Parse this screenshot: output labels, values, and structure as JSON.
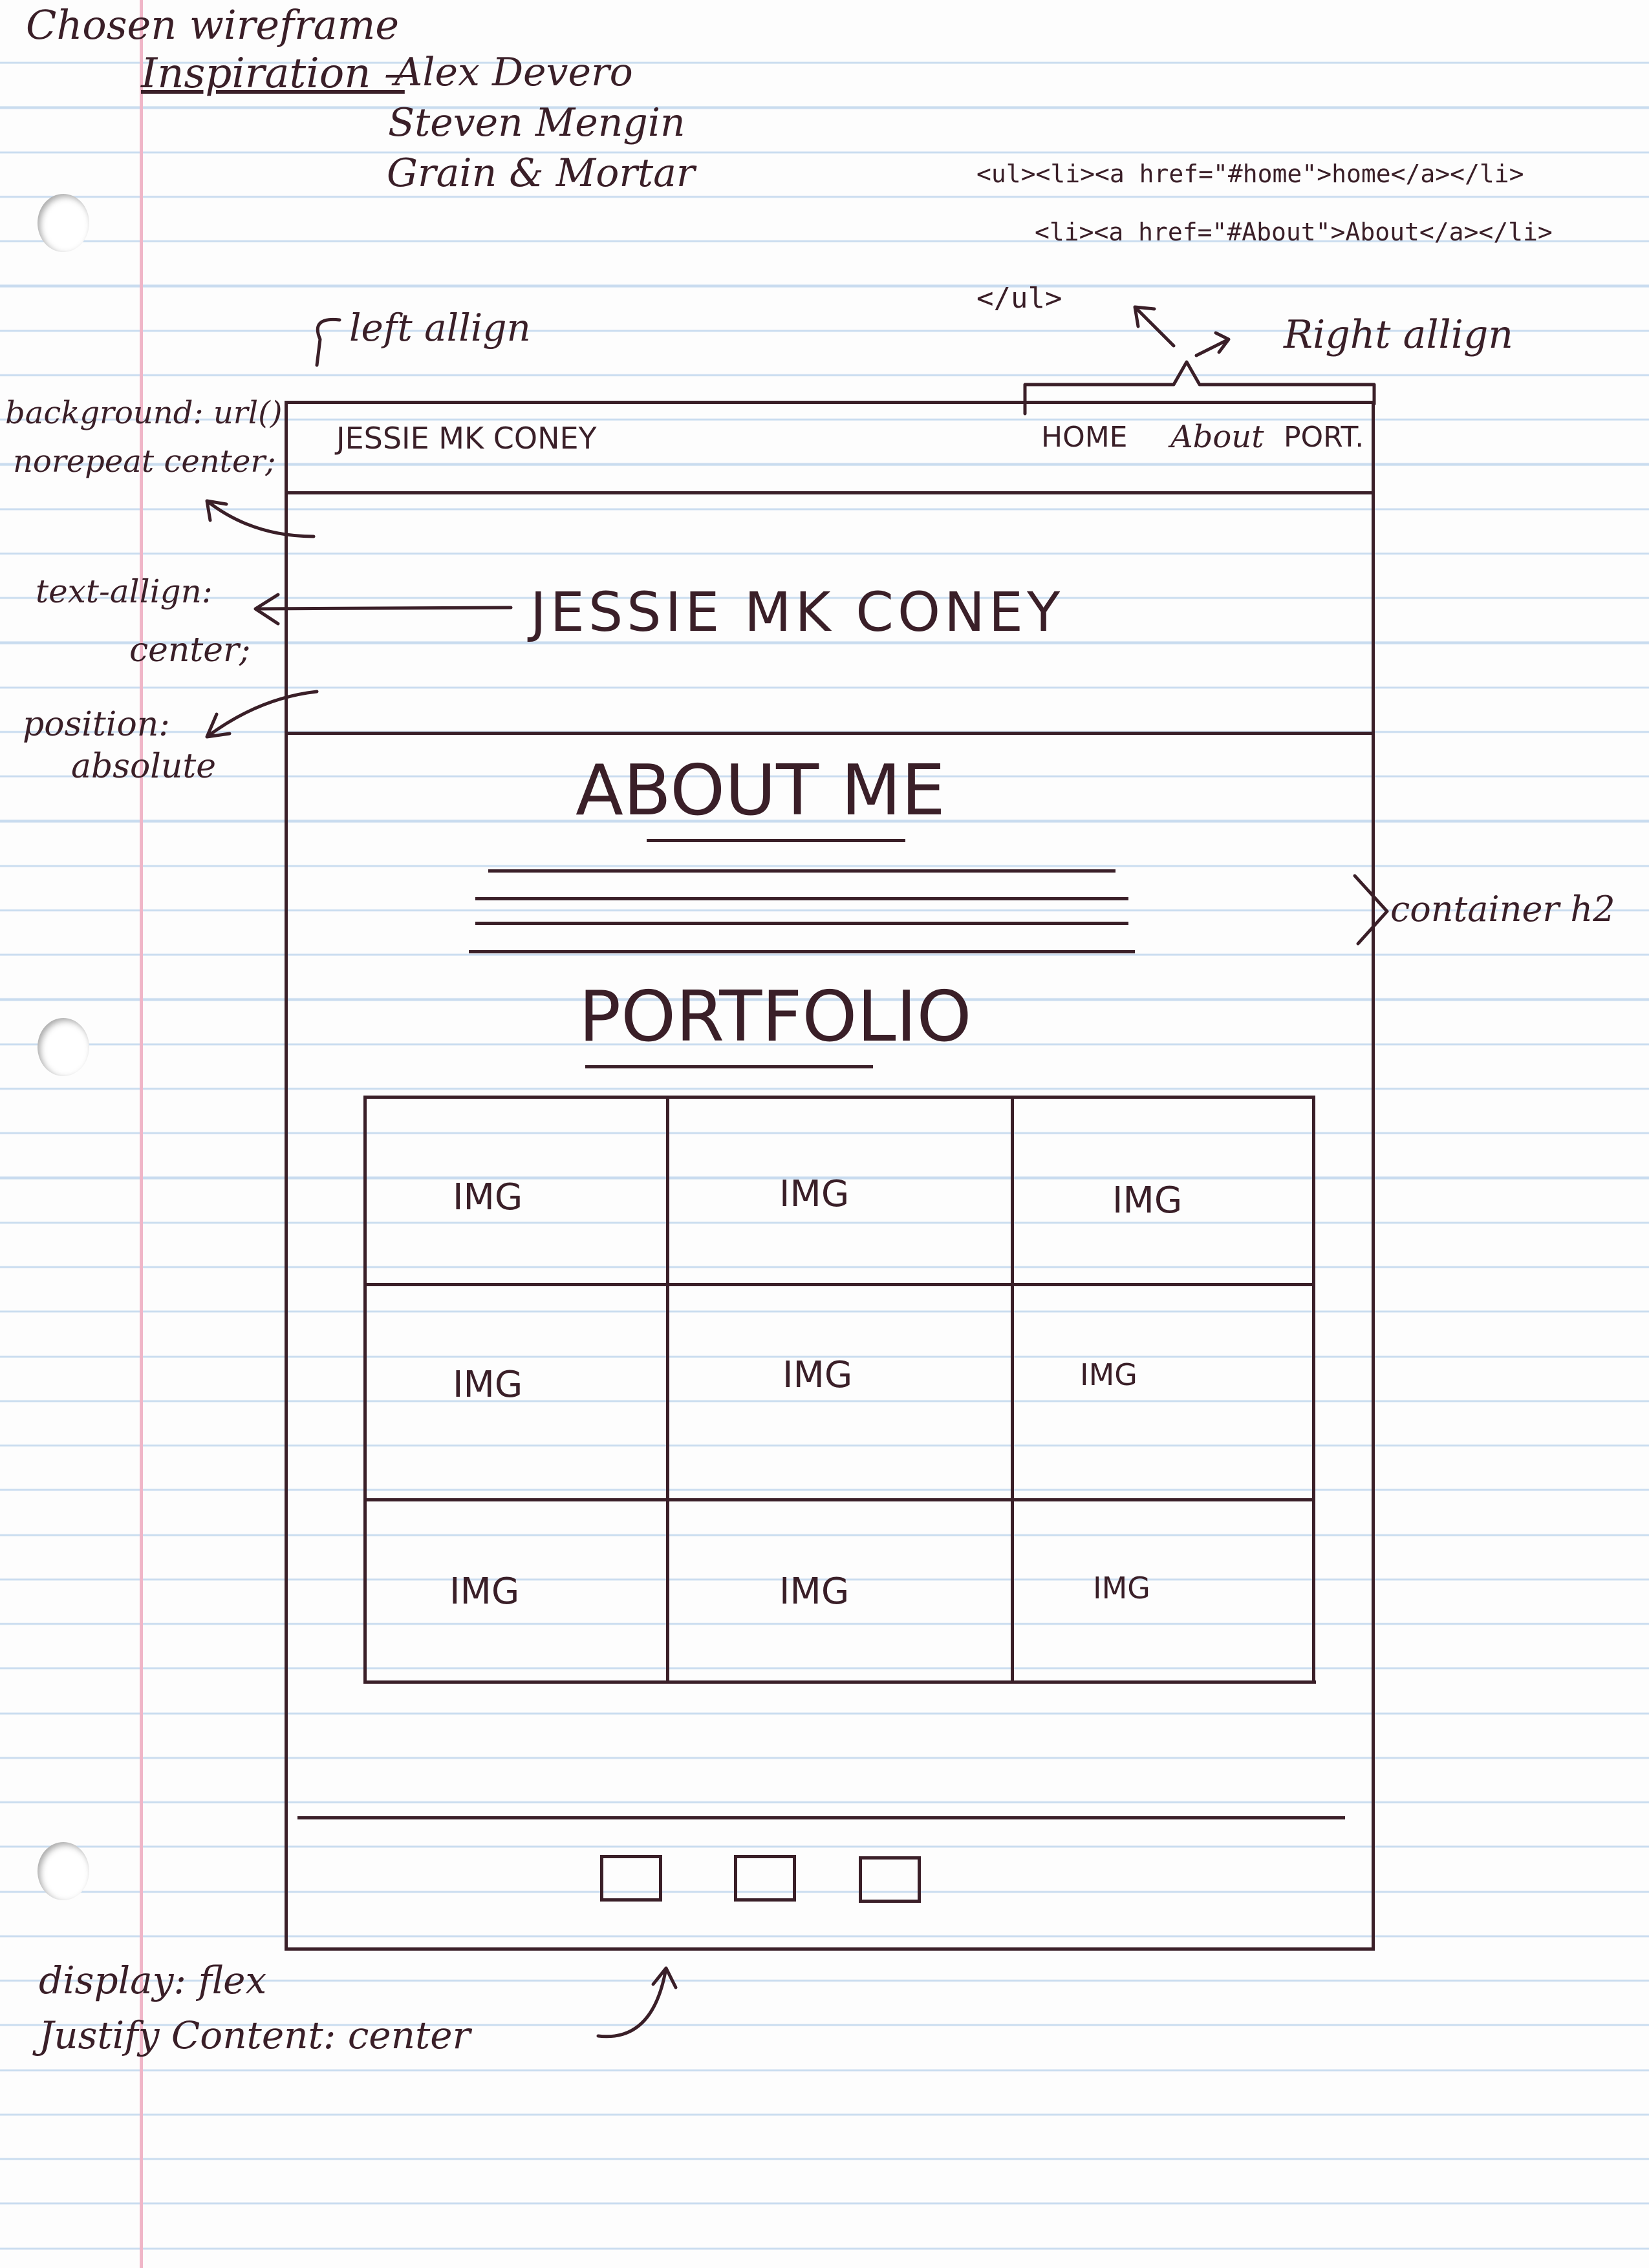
{
  "notes": {
    "heading": "Chosen wireframe",
    "inspiration_label": "Inspiration –",
    "inspiration": [
      "Alex Devero",
      "Steven Mengin",
      "Grain & Mortar"
    ],
    "code_line1": "<ul><li><a href=\"#home\">home</a></li>",
    "code_line2": "<li><a href=\"#About\">About</a></li>",
    "code_line3": "</ul>",
    "right_align": "Right allign",
    "left_align": "left allign",
    "bg_line1": "background: url()",
    "bg_line2": "norepeat center;",
    "text_align_line1": "text-allign:",
    "text_align_line2": "center;",
    "position_line1": "position:",
    "position_line2": "absolute",
    "container": "container h2",
    "flex_line1": "display: flex",
    "flex_line2": "Justify Content: center"
  },
  "wireframe": {
    "nav_brand": "JESSIE MK CONEY",
    "nav_links": [
      "HOME",
      "About",
      "PORT."
    ],
    "hero_title": "JESSIE MK CONEY",
    "about_heading": "ABOUT ME",
    "portfolio_heading": "PORTFOLIO",
    "grid_cells": [
      "IMG",
      "IMG",
      "IMG",
      "IMG",
      "IMG",
      "IMG",
      "IMG",
      "IMG",
      "IMG"
    ]
  },
  "colors": {
    "ink": "#3a1f28",
    "rule": "#c9dcef",
    "margin": "#f0b6c8"
  }
}
